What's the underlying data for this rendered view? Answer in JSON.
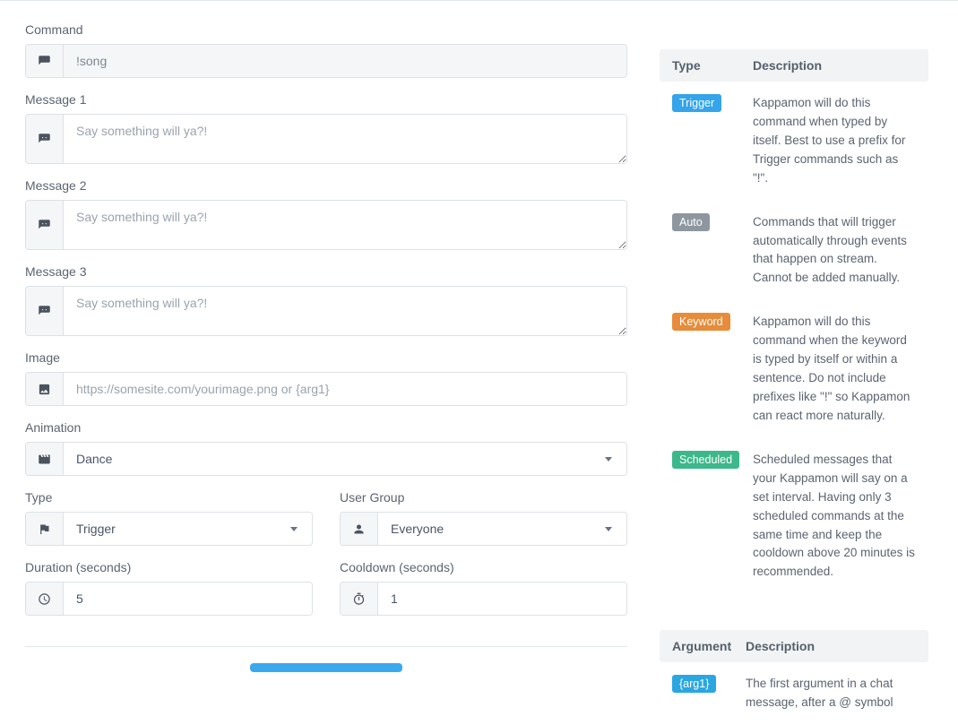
{
  "form": {
    "command": {
      "label": "Command",
      "value": "!song"
    },
    "message1": {
      "label": "Message 1",
      "placeholder": "Say something will ya?!"
    },
    "message2": {
      "label": "Message 2",
      "placeholder": "Say something will ya?!"
    },
    "message3": {
      "label": "Message 3",
      "placeholder": "Say something will ya?!"
    },
    "image": {
      "label": "Image",
      "placeholder": "https://somesite.com/yourimage.png or {arg1}"
    },
    "animation": {
      "label": "Animation",
      "value": "Dance"
    },
    "type": {
      "label": "Type",
      "value": "Trigger"
    },
    "usergroup": {
      "label": "User Group",
      "value": "Everyone"
    },
    "duration": {
      "label": "Duration (seconds)",
      "value": "5"
    },
    "cooldown": {
      "label": "Cooldown (seconds)",
      "value": "1"
    }
  },
  "typeTable": {
    "headers": {
      "type": "Type",
      "description": "Description"
    },
    "rows": [
      {
        "badge": "Trigger",
        "badgeClass": "trigger",
        "desc": "Kappamon will do this command when typed by itself. Best to use a prefix for Trigger commands such as \"!\"."
      },
      {
        "badge": "Auto",
        "badgeClass": "auto",
        "desc": "Commands that will trigger automatically through events that happen on stream. Cannot be added manually."
      },
      {
        "badge": "Keyword",
        "badgeClass": "keyword",
        "desc": "Kappamon will do this command when the keyword is typed by itself or within a sentence. Do not include prefixes like \"!\" so Kappamon can react more naturally."
      },
      {
        "badge": "Scheduled",
        "badgeClass": "scheduled",
        "desc": "Scheduled messages that your Kappamon will say on a set interval. Having only 3 scheduled commands at the same time and keep the cooldown above 20 minutes is recommended."
      }
    ]
  },
  "argTable": {
    "headers": {
      "argument": "Argument",
      "description": "Description"
    },
    "rows": [
      {
        "badge": "{arg1}",
        "desc": "The first argument in a chat message, after a @ symbol"
      }
    ]
  }
}
